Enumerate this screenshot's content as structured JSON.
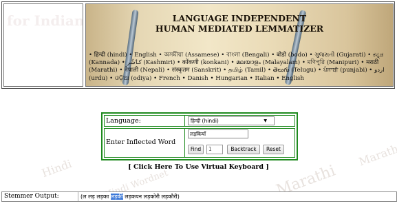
{
  "watermarks": [
    "Hindi",
    "Marathi",
    "Marathi",
    "Hindi Wordnet"
  ],
  "banner": {
    "left_faded_text": "for Indian L",
    "title_line1": "LANGUAGE INDEPENDENT",
    "title_line2": "HUMAN MEDIATED LEMMATIZER",
    "languages": "• हिन्दी (hindi) • English • অসমীয়া (Assamese) • বাংলা (Bengali) • बोडो (bodo) • ગુજરાતી (Gujarati) • ಕನ್ನಡ (Kannada) • کٲشُر (Kashmiri) • कोंकणी (konkani) • മലയാളം (Malayalam) • মণিপুরি (Manipuri) • मराठी (Marathi) • नेपाली (Nepali) • संस्कृतम (Sanskrit) • தமிழ் (Tamil) • తెలుగు (Telugu) • ਪੰਜਾਬੀ (punjabi) • اردو (urdu) • ଓଡ଼ିଆ (odiya) • French • Danish • Hungarian • Italian • English"
  },
  "form": {
    "language_label": "Language:",
    "language_selected": "हिन्दी (hindi)",
    "word_label": "Enter Inflected Word",
    "word_value": "लड़कियाँ",
    "find_label": "Find",
    "count_value": "1",
    "backtrack_label": "Backtrack",
    "reset_label": "Reset"
  },
  "virtual_keyboard_link": "[ Click Here To Use Virtual Keyboard ]",
  "output": {
    "label": "Stemmer Output:",
    "prefix": "(ल लड़ लड़का ",
    "highlighted": "लड़की",
    "suffix": " लड़कपन लड़कोरी लड़कौरी)"
  }
}
